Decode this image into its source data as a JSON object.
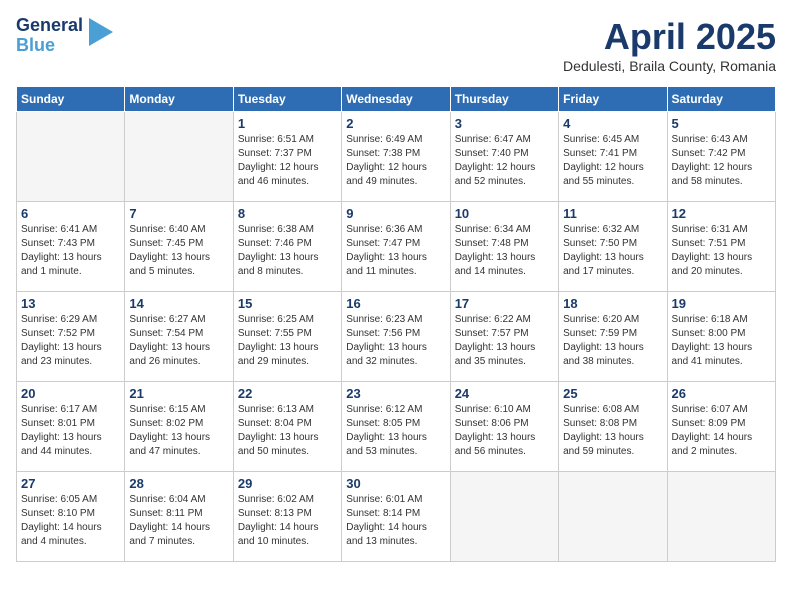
{
  "logo": {
    "line1": "General",
    "line2": "Blue"
  },
  "title": "April 2025",
  "subtitle": "Dedulesti, Braila County, Romania",
  "weekdays": [
    "Sunday",
    "Monday",
    "Tuesday",
    "Wednesday",
    "Thursday",
    "Friday",
    "Saturday"
  ],
  "weeks": [
    [
      {
        "day": "",
        "info": ""
      },
      {
        "day": "",
        "info": ""
      },
      {
        "day": "1",
        "info": "Sunrise: 6:51 AM\nSunset: 7:37 PM\nDaylight: 12 hours\nand 46 minutes."
      },
      {
        "day": "2",
        "info": "Sunrise: 6:49 AM\nSunset: 7:38 PM\nDaylight: 12 hours\nand 49 minutes."
      },
      {
        "day": "3",
        "info": "Sunrise: 6:47 AM\nSunset: 7:40 PM\nDaylight: 12 hours\nand 52 minutes."
      },
      {
        "day": "4",
        "info": "Sunrise: 6:45 AM\nSunset: 7:41 PM\nDaylight: 12 hours\nand 55 minutes."
      },
      {
        "day": "5",
        "info": "Sunrise: 6:43 AM\nSunset: 7:42 PM\nDaylight: 12 hours\nand 58 minutes."
      }
    ],
    [
      {
        "day": "6",
        "info": "Sunrise: 6:41 AM\nSunset: 7:43 PM\nDaylight: 13 hours\nand 1 minute."
      },
      {
        "day": "7",
        "info": "Sunrise: 6:40 AM\nSunset: 7:45 PM\nDaylight: 13 hours\nand 5 minutes."
      },
      {
        "day": "8",
        "info": "Sunrise: 6:38 AM\nSunset: 7:46 PM\nDaylight: 13 hours\nand 8 minutes."
      },
      {
        "day": "9",
        "info": "Sunrise: 6:36 AM\nSunset: 7:47 PM\nDaylight: 13 hours\nand 11 minutes."
      },
      {
        "day": "10",
        "info": "Sunrise: 6:34 AM\nSunset: 7:48 PM\nDaylight: 13 hours\nand 14 minutes."
      },
      {
        "day": "11",
        "info": "Sunrise: 6:32 AM\nSunset: 7:50 PM\nDaylight: 13 hours\nand 17 minutes."
      },
      {
        "day": "12",
        "info": "Sunrise: 6:31 AM\nSunset: 7:51 PM\nDaylight: 13 hours\nand 20 minutes."
      }
    ],
    [
      {
        "day": "13",
        "info": "Sunrise: 6:29 AM\nSunset: 7:52 PM\nDaylight: 13 hours\nand 23 minutes."
      },
      {
        "day": "14",
        "info": "Sunrise: 6:27 AM\nSunset: 7:54 PM\nDaylight: 13 hours\nand 26 minutes."
      },
      {
        "day": "15",
        "info": "Sunrise: 6:25 AM\nSunset: 7:55 PM\nDaylight: 13 hours\nand 29 minutes."
      },
      {
        "day": "16",
        "info": "Sunrise: 6:23 AM\nSunset: 7:56 PM\nDaylight: 13 hours\nand 32 minutes."
      },
      {
        "day": "17",
        "info": "Sunrise: 6:22 AM\nSunset: 7:57 PM\nDaylight: 13 hours\nand 35 minutes."
      },
      {
        "day": "18",
        "info": "Sunrise: 6:20 AM\nSunset: 7:59 PM\nDaylight: 13 hours\nand 38 minutes."
      },
      {
        "day": "19",
        "info": "Sunrise: 6:18 AM\nSunset: 8:00 PM\nDaylight: 13 hours\nand 41 minutes."
      }
    ],
    [
      {
        "day": "20",
        "info": "Sunrise: 6:17 AM\nSunset: 8:01 PM\nDaylight: 13 hours\nand 44 minutes."
      },
      {
        "day": "21",
        "info": "Sunrise: 6:15 AM\nSunset: 8:02 PM\nDaylight: 13 hours\nand 47 minutes."
      },
      {
        "day": "22",
        "info": "Sunrise: 6:13 AM\nSunset: 8:04 PM\nDaylight: 13 hours\nand 50 minutes."
      },
      {
        "day": "23",
        "info": "Sunrise: 6:12 AM\nSunset: 8:05 PM\nDaylight: 13 hours\nand 53 minutes."
      },
      {
        "day": "24",
        "info": "Sunrise: 6:10 AM\nSunset: 8:06 PM\nDaylight: 13 hours\nand 56 minutes."
      },
      {
        "day": "25",
        "info": "Sunrise: 6:08 AM\nSunset: 8:08 PM\nDaylight: 13 hours\nand 59 minutes."
      },
      {
        "day": "26",
        "info": "Sunrise: 6:07 AM\nSunset: 8:09 PM\nDaylight: 14 hours\nand 2 minutes."
      }
    ],
    [
      {
        "day": "27",
        "info": "Sunrise: 6:05 AM\nSunset: 8:10 PM\nDaylight: 14 hours\nand 4 minutes."
      },
      {
        "day": "28",
        "info": "Sunrise: 6:04 AM\nSunset: 8:11 PM\nDaylight: 14 hours\nand 7 minutes."
      },
      {
        "day": "29",
        "info": "Sunrise: 6:02 AM\nSunset: 8:13 PM\nDaylight: 14 hours\nand 10 minutes."
      },
      {
        "day": "30",
        "info": "Sunrise: 6:01 AM\nSunset: 8:14 PM\nDaylight: 14 hours\nand 13 minutes."
      },
      {
        "day": "",
        "info": ""
      },
      {
        "day": "",
        "info": ""
      },
      {
        "day": "",
        "info": ""
      }
    ]
  ]
}
